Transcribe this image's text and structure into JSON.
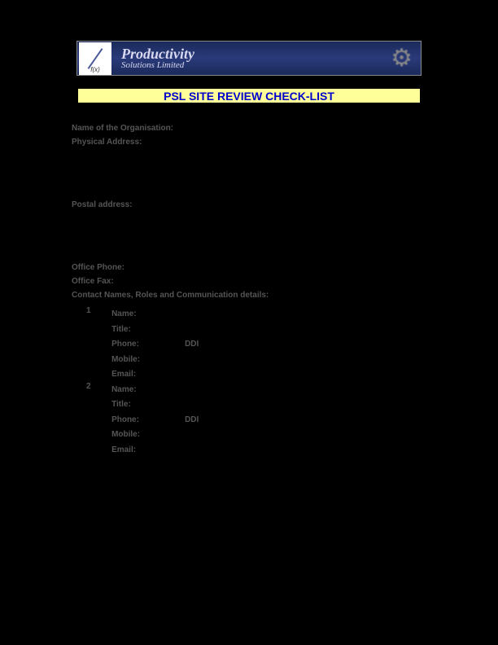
{
  "banner": {
    "logo_sub": "f(x)",
    "title": "Productivity",
    "subtitle": "Solutions Limited"
  },
  "title": "PSL SITE REVIEW CHECK-LIST",
  "fields": {
    "org_name": "Name of the Organisation:",
    "physical_address": "Physical Address:",
    "postal_address": "Postal address:",
    "office_phone": "Office Phone:",
    "office_fax": "Office Fax:",
    "contacts_heading": "Contact Names, Roles and Communication details:"
  },
  "contact_labels": {
    "name": "Name:",
    "title": "Title:",
    "phone": "Phone:",
    "ddi": "DDI",
    "mobile": "Mobile:",
    "email": "Email:"
  },
  "contact_numbers": [
    "1",
    "2"
  ]
}
